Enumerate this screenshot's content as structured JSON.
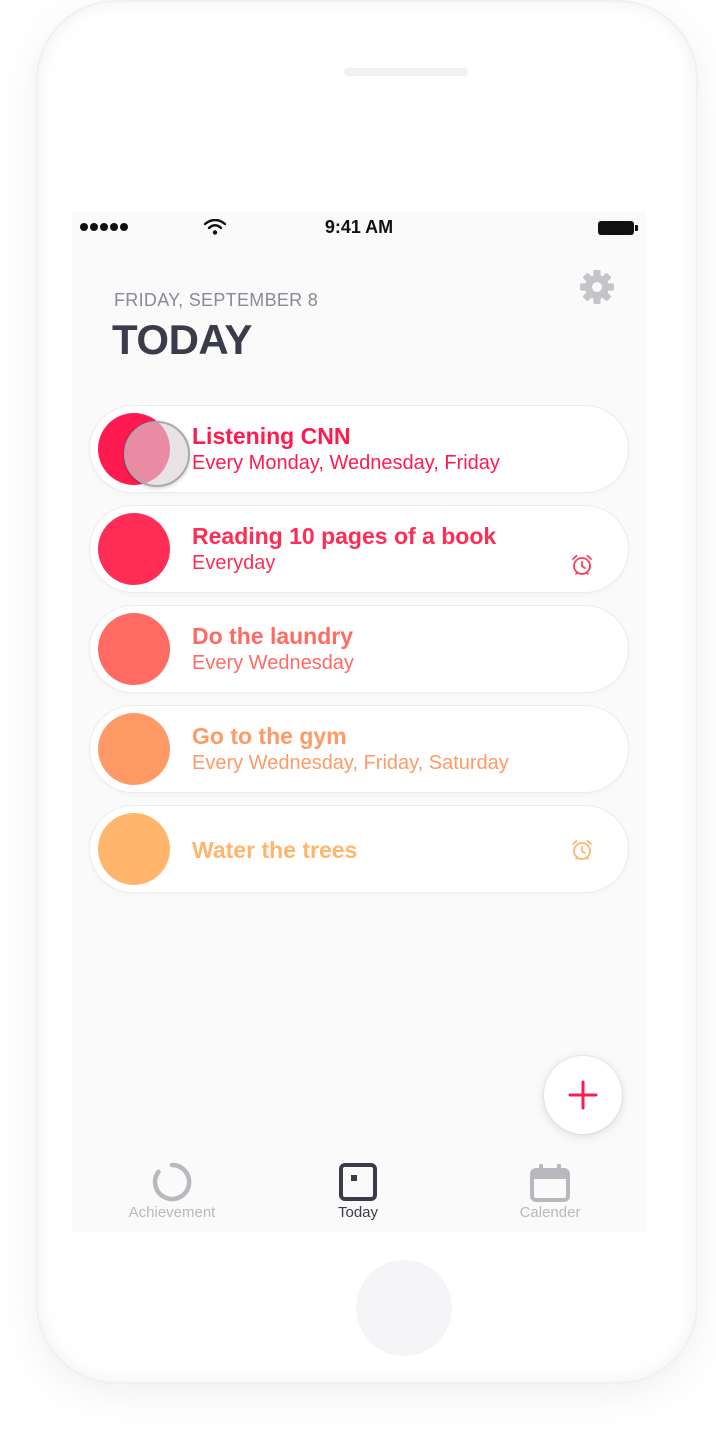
{
  "status_bar": {
    "time": "9:41 AM"
  },
  "header": {
    "date": "FRIDAY, SEPTEMBER 8",
    "title": "TODAY"
  },
  "habits": [
    {
      "name": "Listening CNN",
      "schedule": "Every Monday, Wednesday, Friday",
      "color": "#ff1a4f",
      "alarm": false,
      "touched": true
    },
    {
      "name": "Reading 10 pages of a book",
      "schedule": "Everyday",
      "color": "#ff2d55",
      "alarm": true,
      "alarm_color": "#ff3b5c"
    },
    {
      "name": "Do the laundry",
      "schedule": "Every Wednesday",
      "color": "#ff6b62",
      "alarm": false
    },
    {
      "name": "Go to the gym",
      "schedule": "Every Wednesday, Friday, Saturday",
      "color": "#ff9a66",
      "alarm": false
    },
    {
      "name": "Water the trees",
      "schedule": "",
      "color": "#ffb66c",
      "alarm": true,
      "alarm_color": "#ffb66c"
    }
  ],
  "add_button": {
    "icon": "plus-icon",
    "color": "#ff1a55"
  },
  "tab_bar": {
    "tabs": [
      {
        "label": "Achievement",
        "icon": "progress-ring-icon",
        "active": false
      },
      {
        "label": "Today",
        "icon": "today-square-icon",
        "active": true
      },
      {
        "label": "Calender",
        "icon": "calendar-icon",
        "active": false
      }
    ],
    "active_color": "#3b3c4a",
    "inactive_color": "#b8b8be"
  },
  "colors": {
    "title": "#3b3c4a",
    "date": "#8a8a94",
    "gear": "#c4c4c9"
  }
}
